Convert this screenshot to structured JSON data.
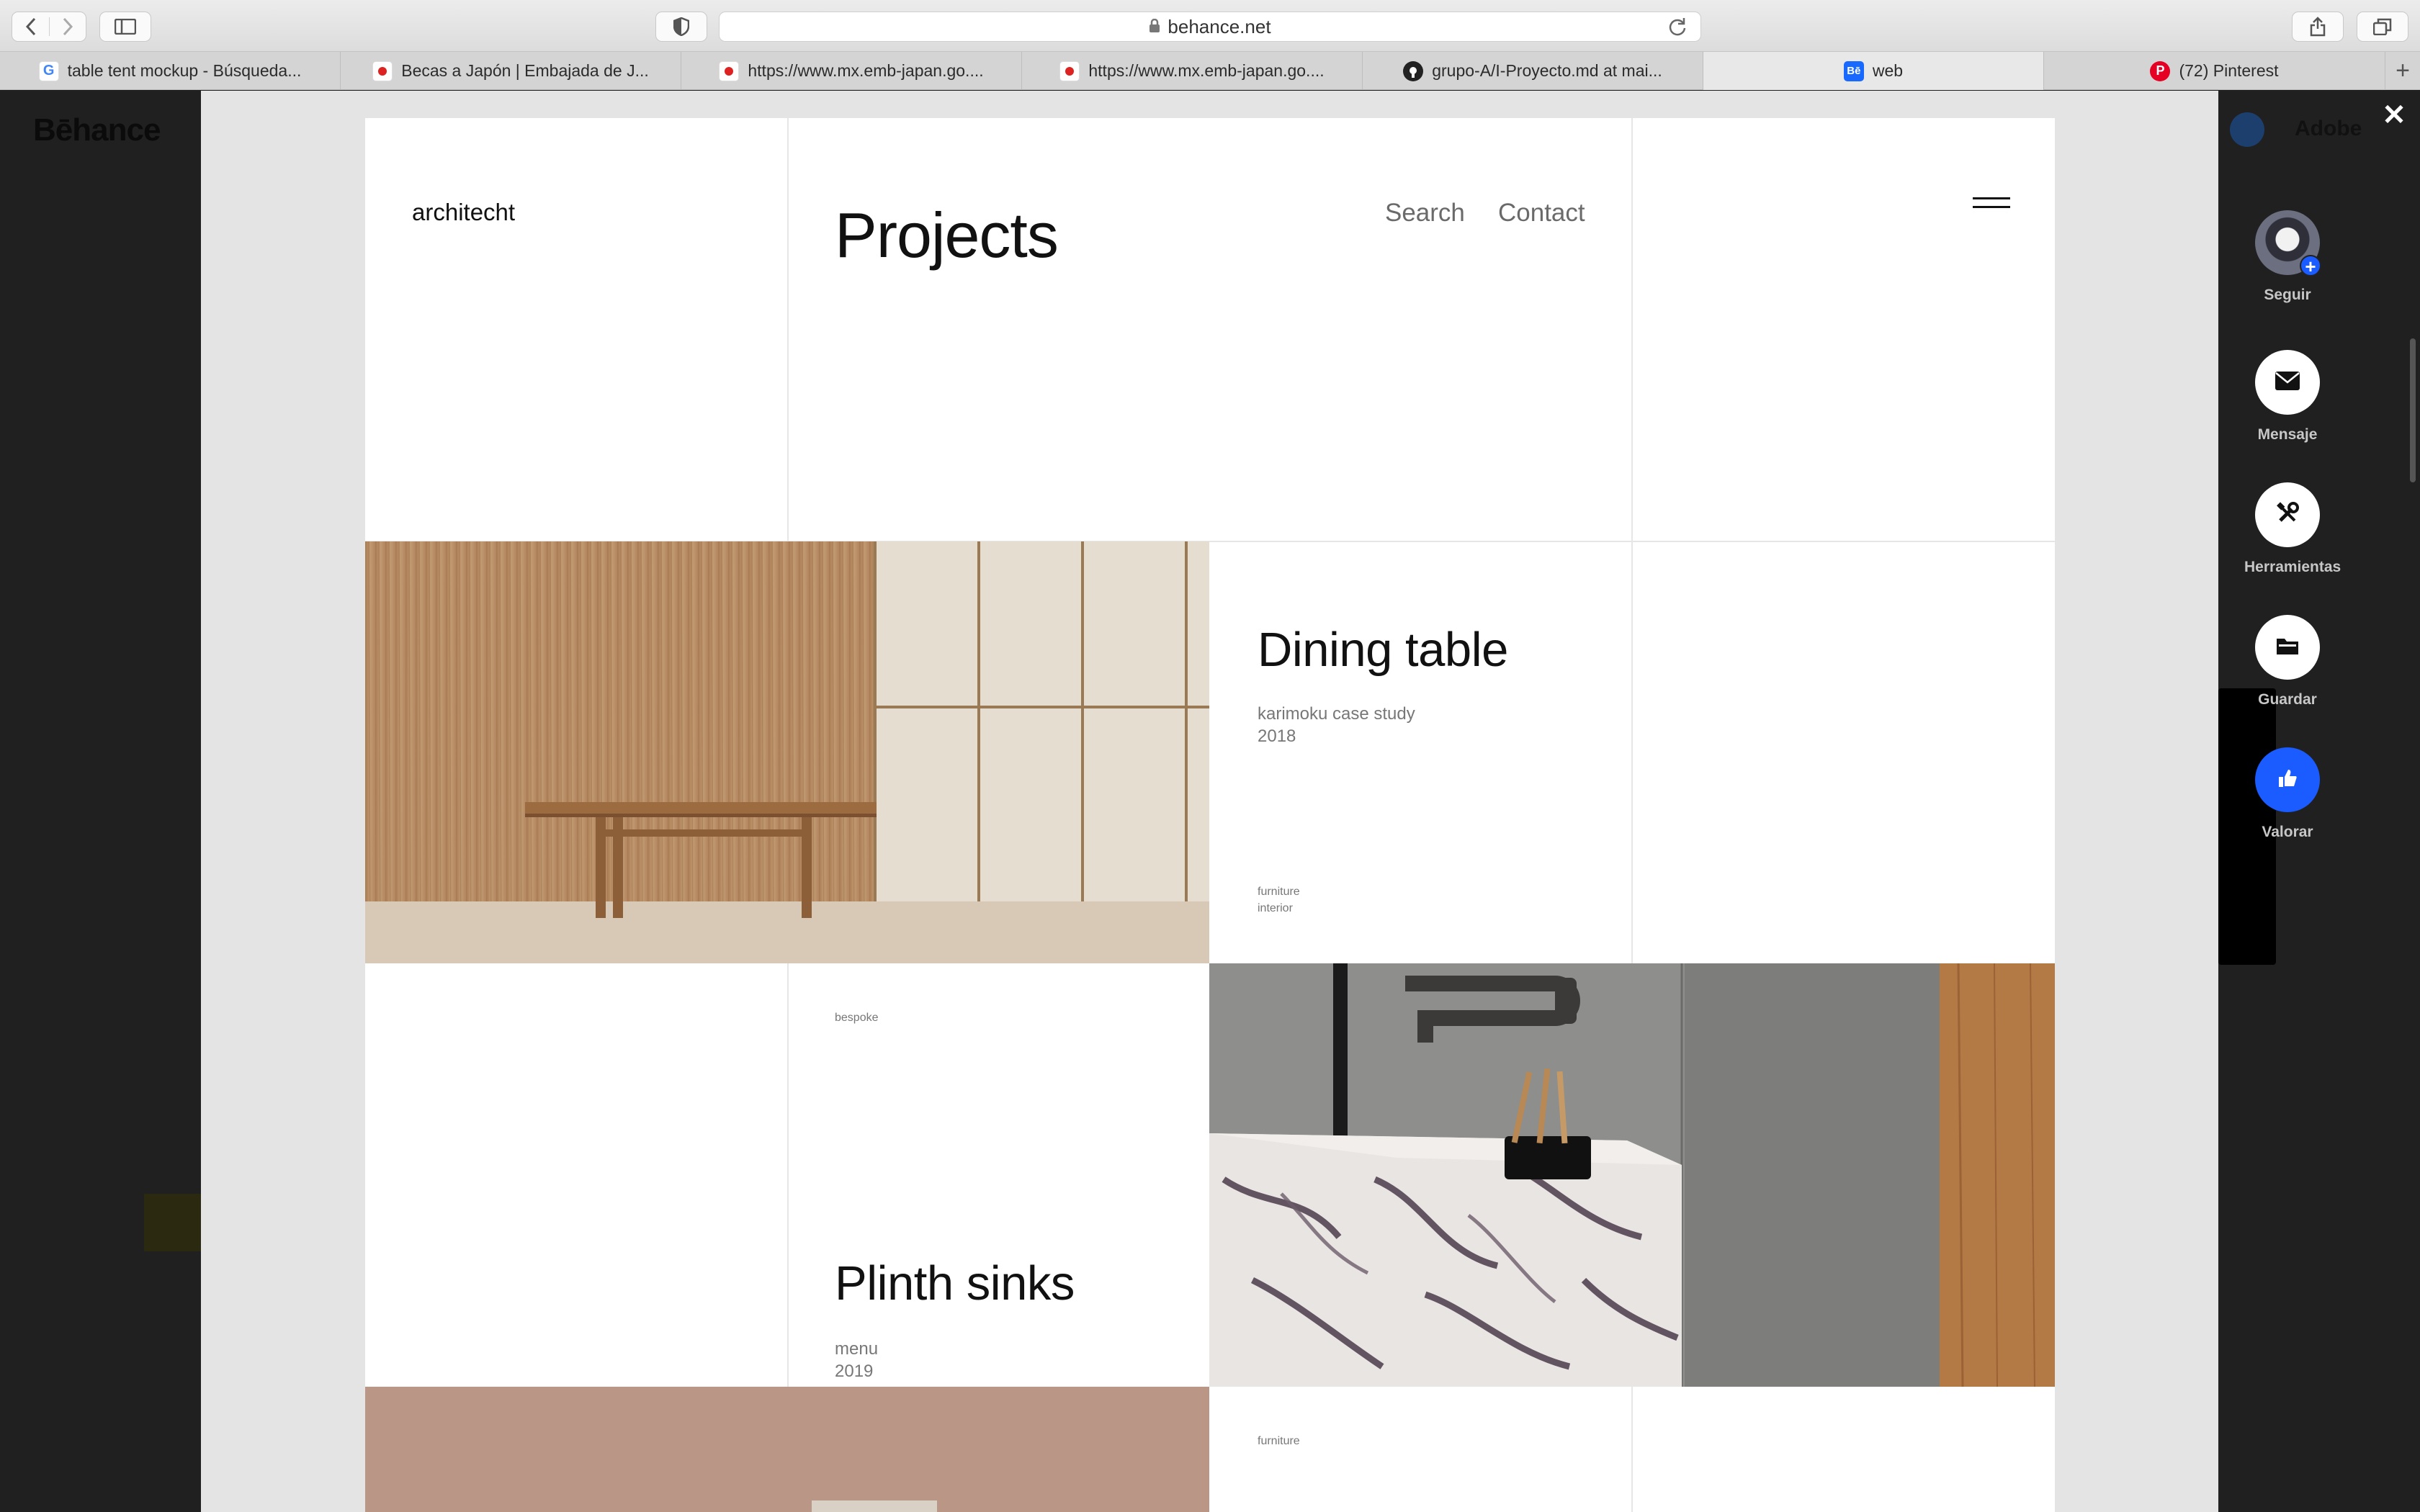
{
  "browser": {
    "url": "behance.net",
    "tabs": [
      {
        "title": "table tent mockup - Búsqueda...",
        "icon": "google-icon"
      },
      {
        "title": "Becas a Japón | Embajada de J...",
        "icon": "japan-flag-icon"
      },
      {
        "title": "https://www.mx.emb-japan.go....",
        "icon": "japan-flag-icon"
      },
      {
        "title": "https://www.mx.emb-japan.go....",
        "icon": "japan-flag-icon"
      },
      {
        "title": "grupo-A/I-Proyecto.md at mai...",
        "icon": "github-icon"
      },
      {
        "title": "web",
        "icon": "behance-icon"
      },
      {
        "title": "(72) Pinterest",
        "icon": "pinterest-icon"
      }
    ]
  },
  "behance": {
    "logo": "Bēhance",
    "adobe": "Adobe"
  },
  "project": {
    "brand": "architecht",
    "title": "Projects",
    "nav": {
      "search": "Search",
      "contact": "Contact"
    },
    "items": [
      {
        "title": "Dining table",
        "subtitle": "karimoku case study",
        "year": "2018",
        "tags": [
          "furniture",
          "interior"
        ]
      },
      {
        "title": "Plinth sinks",
        "subtitle": "menu",
        "year": "2019",
        "tag": "bespoke"
      },
      {
        "tag": "furniture"
      }
    ]
  },
  "actions": {
    "follow": "Seguir",
    "message": "Mensaje",
    "tools": "Herramientas",
    "save": "Guardar",
    "appreciate": "Valorar"
  },
  "colors": {
    "accent": "#1a5cff",
    "wood": "#b58b63",
    "marble": "#e9e5e2",
    "concrete": "#8f8f8f"
  }
}
